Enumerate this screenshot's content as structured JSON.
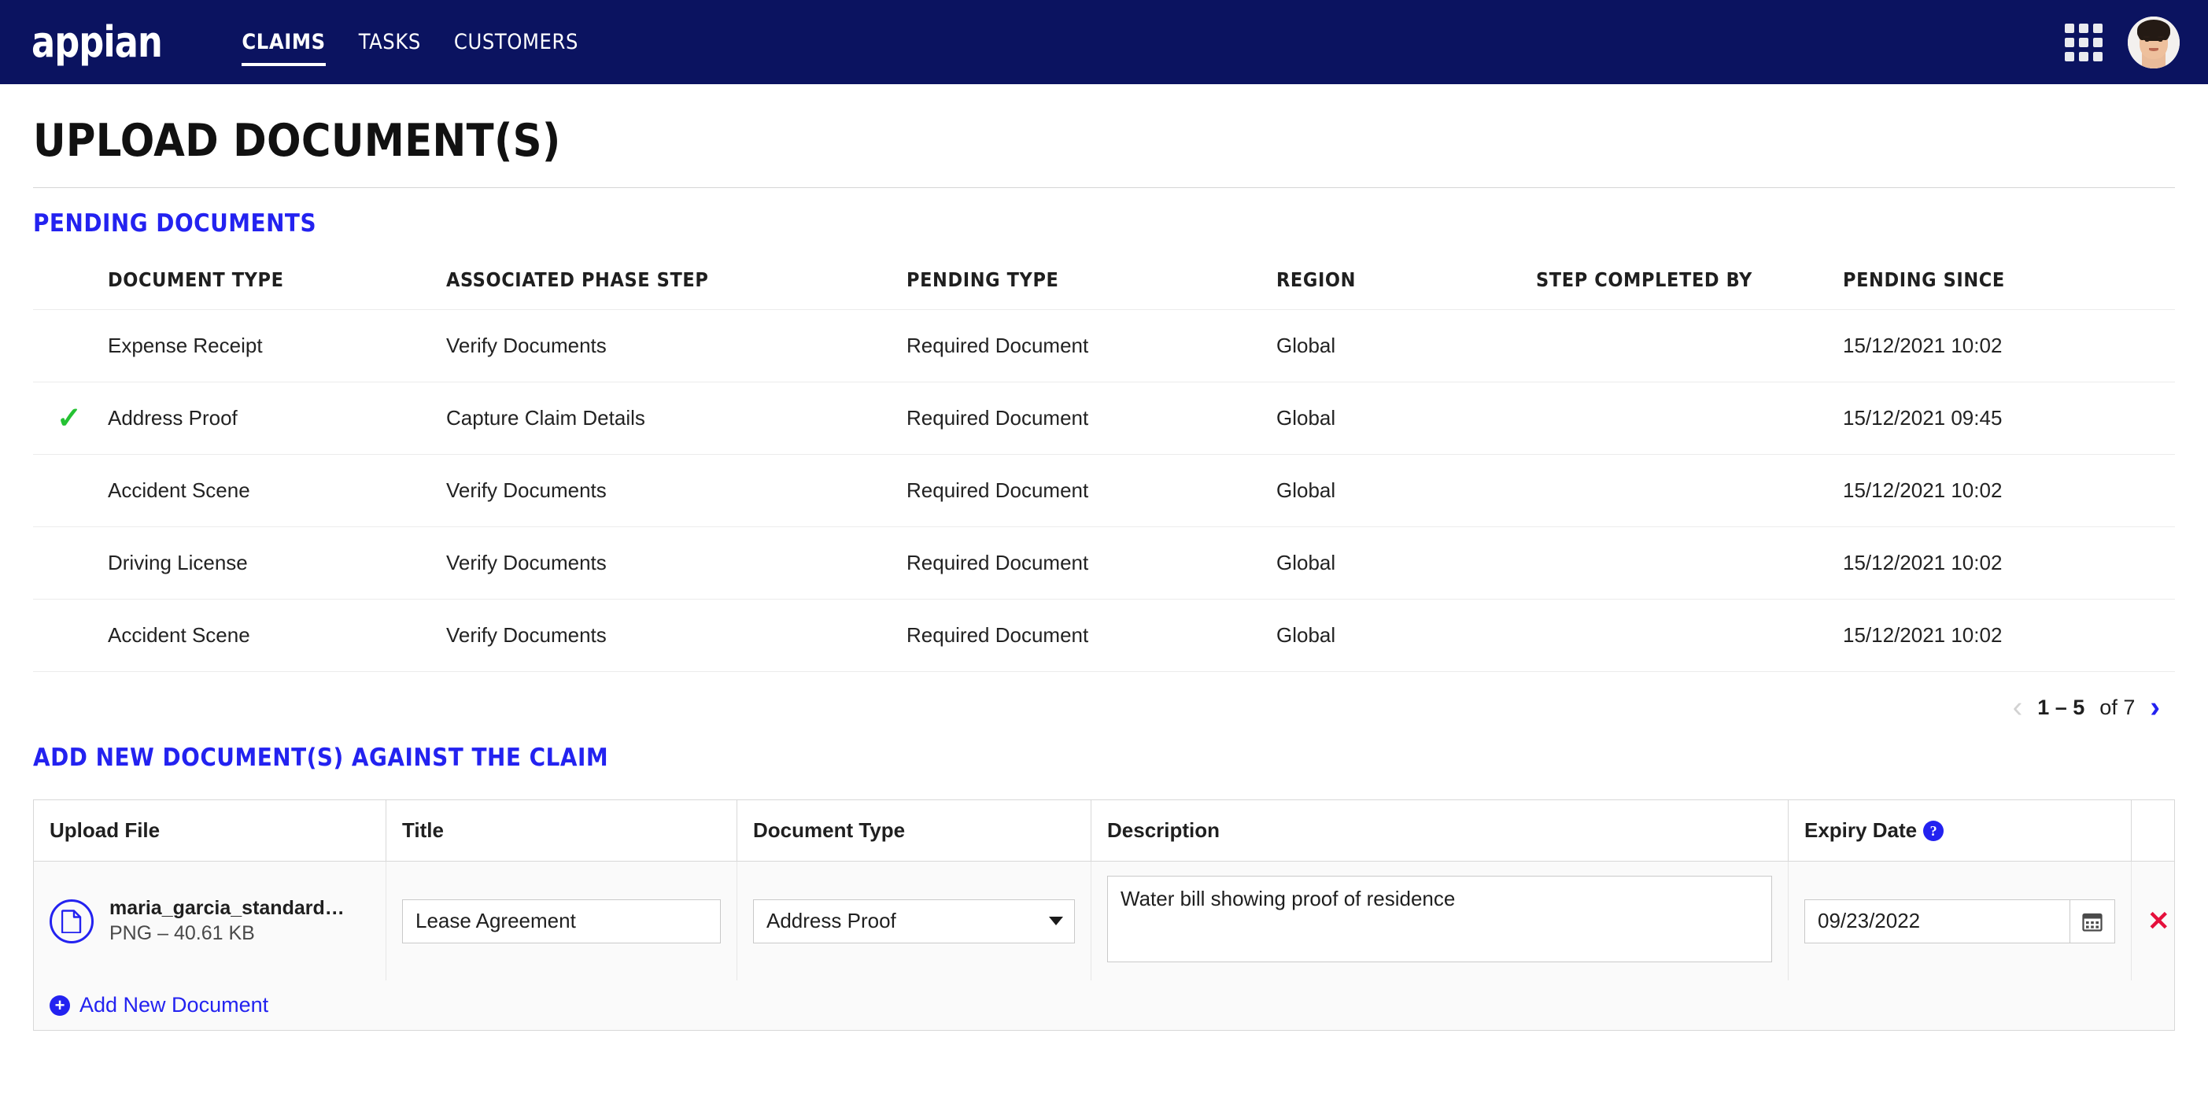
{
  "nav": {
    "brand": "appian",
    "links": [
      {
        "label": "CLAIMS",
        "active": true
      },
      {
        "label": "TASKS",
        "active": false
      },
      {
        "label": "CUSTOMERS",
        "active": false
      }
    ],
    "grid_icon": "apps-grid-icon",
    "avatar_icon": "user-avatar"
  },
  "page": {
    "title": "UPLOAD DOCUMENT(S)"
  },
  "pending_section": {
    "heading": "PENDING DOCUMENTS",
    "columns": [
      "",
      "DOCUMENT TYPE",
      "ASSOCIATED PHASE STEP",
      "PENDING TYPE",
      "REGION",
      "STEP COMPLETED BY",
      "PENDING SINCE"
    ],
    "rows": [
      {
        "checked": false,
        "document_type": "Expense Receipt",
        "phase_step": "Verify Documents",
        "pending_type": "Required Document",
        "region": "Global",
        "completed_by": "user-avatar",
        "pending_since": "15/12/2021 10:02"
      },
      {
        "checked": true,
        "document_type": "Address Proof",
        "phase_step": "Capture Claim Details",
        "pending_type": "Required Document",
        "region": "Global",
        "completed_by": "user-avatar",
        "pending_since": "15/12/2021 09:45"
      },
      {
        "checked": false,
        "document_type": "Accident Scene",
        "phase_step": "Verify Documents",
        "pending_type": "Required Document",
        "region": "Global",
        "completed_by": "user-avatar",
        "pending_since": "15/12/2021 10:02"
      },
      {
        "checked": false,
        "document_type": "Driving License",
        "phase_step": "Verify Documents",
        "pending_type": "Required Document",
        "region": "Global",
        "completed_by": "user-avatar",
        "pending_since": "15/12/2021 10:02"
      },
      {
        "checked": false,
        "document_type": "Accident Scene",
        "phase_step": "Verify Documents",
        "pending_type": "Required Document",
        "region": "Global",
        "completed_by": "user-avatar",
        "pending_since": "15/12/2021 10:02"
      }
    ],
    "pagination": {
      "prev_icon": "chevron-left-icon",
      "next_icon": "chevron-right-icon",
      "range": "1 – 5",
      "total": "of 7",
      "prev_enabled": false,
      "next_enabled": true
    },
    "check_icon": "green-check-icon"
  },
  "add_section": {
    "heading": "ADD NEW DOCUMENT(S) AGAINST THE CLAIM",
    "columns": {
      "upload_file": "Upload File",
      "title": "Title",
      "document_type": "Document Type",
      "description": "Description",
      "expiry_date": "Expiry Date",
      "expiry_help_icon": "?"
    },
    "row": {
      "file_icon": "document-file-icon",
      "file_name": "maria_garcia_standard_re…",
      "file_meta": "PNG – 40.61 KB",
      "title_value": "Lease Agreement",
      "title_placeholder": "",
      "document_type_value": "Address Proof",
      "description_value": "Water bill showing proof of residence",
      "description_placeholder": "",
      "expiry_value": "09/23/2022",
      "expiry_placeholder": "",
      "calendar_icon": "calendar-icon",
      "delete_icon": "✕"
    },
    "add_new": {
      "label": "Add New Document",
      "icon": "plus-circle-icon"
    }
  },
  "colors": {
    "nav_background": "#0b1360",
    "accent_blue": "#2322f0",
    "check_green": "#25c233",
    "delete_red": "#e5103c"
  }
}
